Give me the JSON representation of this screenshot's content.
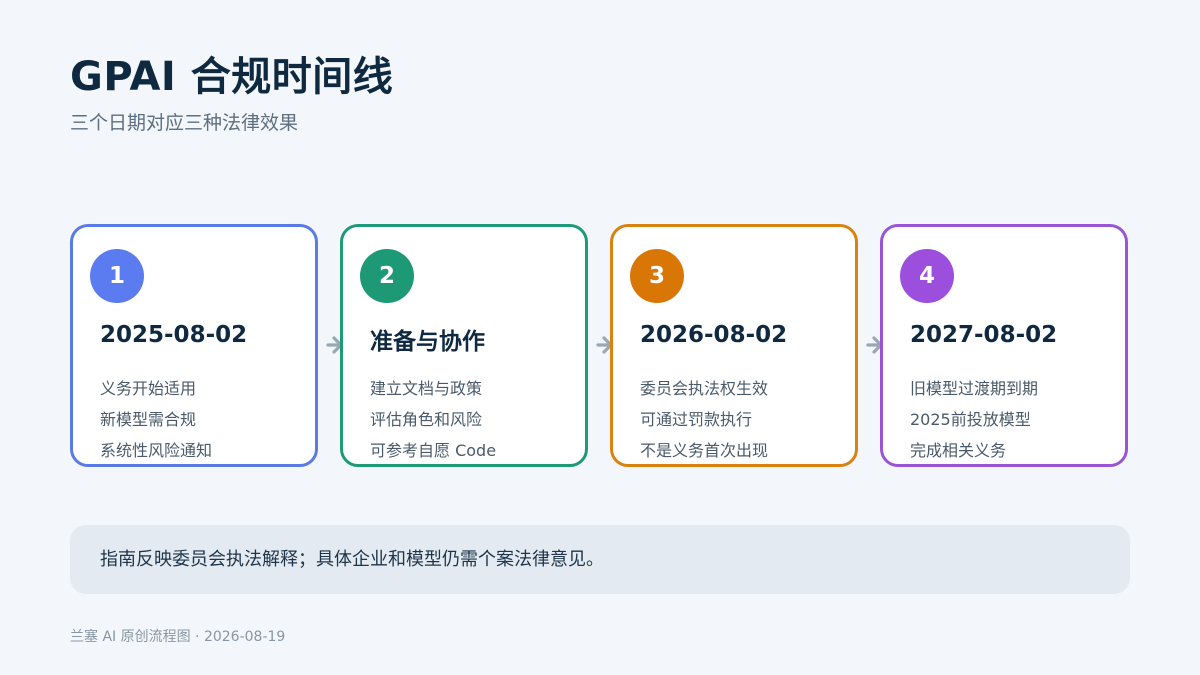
{
  "title": "GPAI 合规时间线",
  "subtitle": "三个日期对应三种法律效果",
  "steps": [
    {
      "number": "1",
      "heading": "2025-08-02",
      "color": "#5a7be6",
      "badge_color": "#5b7cf0",
      "lines": [
        "义务开始适用",
        "新模型需合规",
        "系统性风险通知"
      ]
    },
    {
      "number": "2",
      "heading": "准备与协作",
      "color": "#1e9a76",
      "badge_color": "#1d9a75",
      "lines": [
        "建立文档与政策",
        "评估角色和风险",
        "可参考自愿 Code"
      ]
    },
    {
      "number": "3",
      "heading": "2026-08-02",
      "color": "#d9820f",
      "badge_color": "#d97706",
      "lines": [
        "委员会执法权生效",
        "可通过罚款执行",
        "不是义务首次出现"
      ]
    },
    {
      "number": "4",
      "heading": "2027-08-02",
      "color": "#9a55d6",
      "badge_color": "#9b4fdc",
      "lines": [
        "旧模型过渡期到期",
        "2025前投放模型",
        "完成相关义务"
      ]
    }
  ],
  "note": "指南反映委员会执法解释；具体企业和模型仍需个案法律意见。",
  "footer": "兰塞 AI 原创流程图 · 2026-08-19",
  "arrow_color": "#9aa8b6"
}
